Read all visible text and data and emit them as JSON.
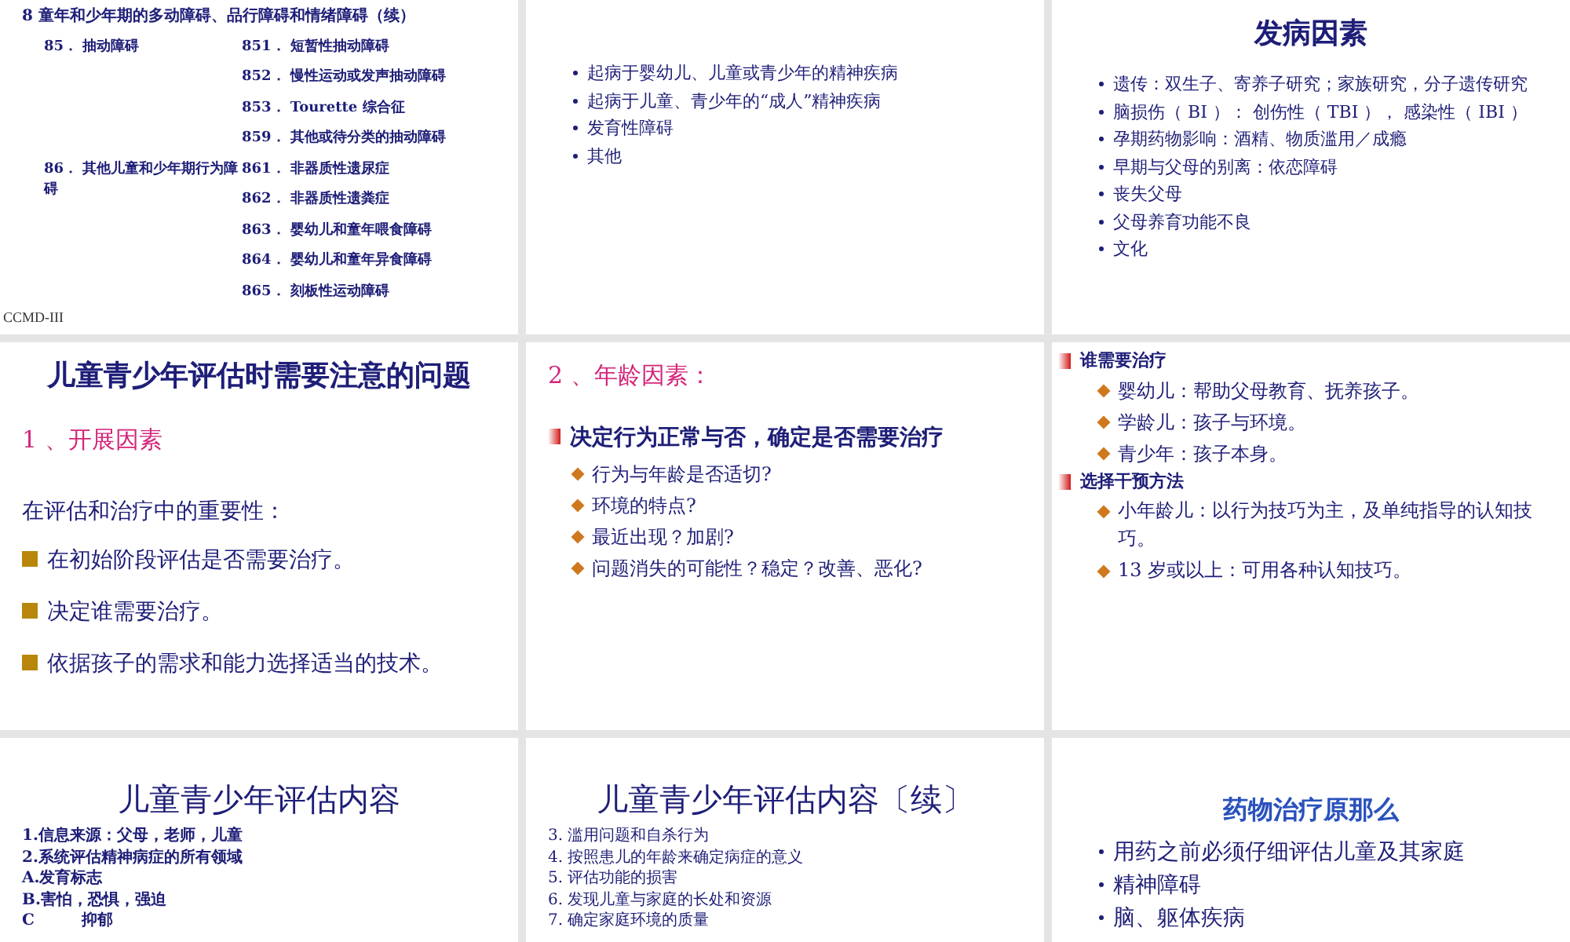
{
  "slides": [
    {
      "blocks": [
        {
          "kind": "line-bold",
          "text": "8 童年和少年期的多动障碍、品行障碍和情绪障碍（续）"
        },
        {
          "kind": "code-group",
          "text": "85． 抽动障碍",
          "children": [
            "851． 短暂性抽动障碍",
            "852． 慢性运动或发声抽动障碍",
            "853． Tourette 综合征",
            "859． 其他或待分类的抽动障碍"
          ]
        },
        {
          "kind": "code-group",
          "text": "86． 其他儿童和少年期行为障碍",
          "children": [
            "861． 非器质性遗尿症",
            "862． 非器质性遗粪症",
            "863． 婴幼儿和童年喂食障碍",
            "864． 婴幼儿和童年异食障碍",
            "865． 刻板性运动障碍"
          ]
        },
        {
          "kind": "caption",
          "text": "CCMD-III"
        }
      ]
    },
    {
      "blocks": [
        {
          "kind": "spacer"
        },
        {
          "kind": "bullet",
          "text": "起病于婴幼儿、儿童或青少年的精神疾病"
        },
        {
          "kind": "bullet",
          "text": "起病于儿童、青少年的“成人”精神疾病"
        },
        {
          "kind": "bullet",
          "text": "发育性障碍"
        },
        {
          "kind": "bullet",
          "text": "其他"
        }
      ]
    },
    {
      "blocks": [
        {
          "kind": "title",
          "text": "发病因素"
        },
        {
          "kind": "bullet",
          "text": "遗传：双生子、寄养子研究；家族研究，分子遗传研究"
        },
        {
          "kind": "bullet",
          "text": "脑损伤（ BI ）： 创伤性（ TBI ）， 感染性（ IBI ）"
        },
        {
          "kind": "bullet",
          "text": "孕期药物影响：酒精、物质滥用／成瘾"
        },
        {
          "kind": "bullet",
          "text": "早期与父母的别离：依恋障碍"
        },
        {
          "kind": "bullet",
          "text": "丧失父母"
        },
        {
          "kind": "bullet",
          "text": "父母养育功能不良"
        },
        {
          "kind": "bullet",
          "text": "文化"
        }
      ]
    },
    {
      "blocks": [
        {
          "kind": "title",
          "text": "儿童青少年评估时需要注意的问题"
        },
        {
          "kind": "heading-pink",
          "text": "1 、开展因素"
        },
        {
          "kind": "text",
          "text": "在评估和治疗中的重要性："
        },
        {
          "kind": "square",
          "text": "在初始阶段评估是否需要治疗。"
        },
        {
          "kind": "square",
          "text": "决定谁需要治疗。"
        },
        {
          "kind": "square",
          "text": "依据孩子的需求和能力选择适当的技术。"
        }
      ]
    },
    {
      "blocks": [
        {
          "kind": "heading-pink",
          "text": "2 、年龄因素："
        },
        {
          "kind": "red",
          "text": "决定行为正常与否，确定是否需要治疗"
        },
        {
          "kind": "diamond",
          "text": "行为与年龄是否适切?"
        },
        {
          "kind": "diamond",
          "text": "环境的特点?"
        },
        {
          "kind": "diamond",
          "text": "最近出现？加剧?"
        },
        {
          "kind": "diamond",
          "text": "问题消失的可能性？稳定？改善、恶化?"
        }
      ]
    },
    {
      "blocks": [
        {
          "kind": "red-small",
          "text": "谁需要治疗"
        },
        {
          "kind": "diamond",
          "text": "婴幼儿：帮助父母教育、抚养孩子。"
        },
        {
          "kind": "diamond",
          "text": "学龄儿：孩子与环境。"
        },
        {
          "kind": "diamond",
          "text": "青少年：孩子本身。"
        },
        {
          "kind": "red-small",
          "text": "选择干预方法"
        },
        {
          "kind": "diamond",
          "text": "小年龄儿：以行为技巧为主，及单纯指导的认知技巧。"
        },
        {
          "kind": "diamond",
          "text": "13 岁或以上：可用各种认知技巧。"
        }
      ]
    },
    {
      "blocks": [
        {
          "kind": "title-light",
          "text": "儿童青少年评估内容"
        },
        {
          "kind": "line-bold",
          "text": "1.信息来源：父母，老师，儿童"
        },
        {
          "kind": "line-bold",
          "text": "2.系统评估精神病症的所有领域"
        },
        {
          "kind": "line-bold",
          "text": "A.发育标志"
        },
        {
          "kind": "line-bold",
          "text": "B.害怕，恐惧，强迫"
        },
        {
          "kind": "line-bold",
          "text": "C　　　抑郁"
        }
      ]
    },
    {
      "blocks": [
        {
          "kind": "title-light",
          "text": "儿童青少年评估内容〔续〕"
        },
        {
          "kind": "line",
          "text": "3. 滥用问题和自杀行为"
        },
        {
          "kind": "line",
          "text": "4. 按照患儿的年龄来确定病症的意义"
        },
        {
          "kind": "line",
          "text": "5. 评估功能的损害"
        },
        {
          "kind": "line",
          "text": "6. 发现儿童与家庭的长处和资源"
        },
        {
          "kind": "line",
          "text": "7. 确定家庭环境的质量"
        }
      ]
    },
    {
      "blocks": [
        {
          "kind": "title-blue",
          "text": "药物治疗原那么"
        },
        {
          "kind": "spacer"
        },
        {
          "kind": "bullet-big",
          "text": "用药之前必须仔细评估儿童及其家庭"
        },
        {
          "kind": "bullet-big",
          "text": "精神障碍"
        },
        {
          "kind": "bullet-big",
          "text": "脑、躯体疾病"
        }
      ]
    }
  ]
}
